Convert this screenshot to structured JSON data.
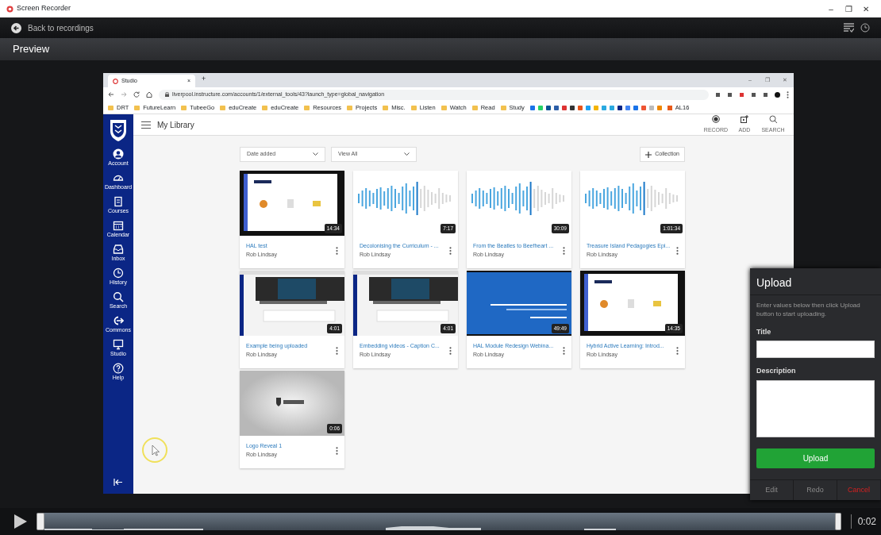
{
  "window": {
    "title": "Screen Recorder",
    "controls": [
      "–",
      "❐",
      "✕"
    ]
  },
  "back_link": "Back to recordings",
  "header": "Preview",
  "browser": {
    "tab_title": "Studio",
    "tab_close": "×",
    "new_tab": "+",
    "window_controls": [
      "–",
      "❐",
      "✕"
    ],
    "url": "liverpool.instructure.com/accounts/1/external_tools/43?launch_type=global_navigation",
    "bookmarks": [
      {
        "label": "DRT"
      },
      {
        "label": "FutureLearn"
      },
      {
        "label": "TubeeGo"
      },
      {
        "label": "eduCreate"
      },
      {
        "label": "eduCreate"
      },
      {
        "label": "Resources"
      },
      {
        "label": "Projects"
      },
      {
        "label": "Misc."
      },
      {
        "label": "Listen"
      },
      {
        "label": "Watch"
      },
      {
        "label": "Read"
      },
      {
        "label": "Study"
      }
    ],
    "bookmark_last": "AL16"
  },
  "sidebar": {
    "items": [
      {
        "label": "Account"
      },
      {
        "label": "Dashboard"
      },
      {
        "label": "Courses"
      },
      {
        "label": "Calendar"
      },
      {
        "label": "Inbox"
      },
      {
        "label": "History"
      },
      {
        "label": "Search"
      },
      {
        "label": "Commons"
      },
      {
        "label": "Studio"
      },
      {
        "label": "Help"
      }
    ]
  },
  "library": {
    "title": "My Library",
    "actions": [
      {
        "label": "RECORD"
      },
      {
        "label": "ADD"
      },
      {
        "label": "SEARCH"
      }
    ],
    "sort": "Date added",
    "filter": "View All",
    "collection_button": "Collection",
    "videos": [
      {
        "title": "HAL test",
        "author": "Rob Lindsay",
        "duration": "14:34",
        "kind": "slides"
      },
      {
        "title": "Decolonising the Curriculum - ...",
        "author": "Rob Lindsay",
        "duration": "7:17",
        "kind": "audio"
      },
      {
        "title": "From the Beatles to Beefheart ...",
        "author": "Rob Lindsay",
        "duration": "30:09",
        "kind": "audio"
      },
      {
        "title": "Treasure Island Pedagogies Epi...",
        "author": "Rob Lindsay",
        "duration": "1:01:34",
        "kind": "audio"
      },
      {
        "title": "Example being uploaded",
        "author": "Rob Lindsay",
        "duration": "4:01",
        "kind": "screen"
      },
      {
        "title": "Embedding videos - Caption C...",
        "author": "Rob Lindsay",
        "duration": "4:01",
        "kind": "screen"
      },
      {
        "title": "HAL Module Redesign Webina...",
        "author": "Rob Lindsay",
        "duration": "49:49",
        "kind": "webinar"
      },
      {
        "title": "Hybrid Active Learning: Introd...",
        "author": "Rob Lindsay",
        "duration": "14:35",
        "kind": "slides"
      },
      {
        "title": "Logo Reveal 1",
        "author": "Rob Lindsay",
        "duration": "0:06",
        "kind": "logo"
      }
    ]
  },
  "upload": {
    "title": "Upload",
    "instructions": "Enter values below then click Upload button to start uploading.",
    "title_label": "Title",
    "description_label": "Description",
    "submit": "Upload",
    "actions": [
      {
        "label": "Edit",
        "kind": "normal"
      },
      {
        "label": "Redo",
        "kind": "normal"
      },
      {
        "label": "Cancel",
        "kind": "danger"
      }
    ]
  },
  "player": {
    "time": "0:02"
  }
}
